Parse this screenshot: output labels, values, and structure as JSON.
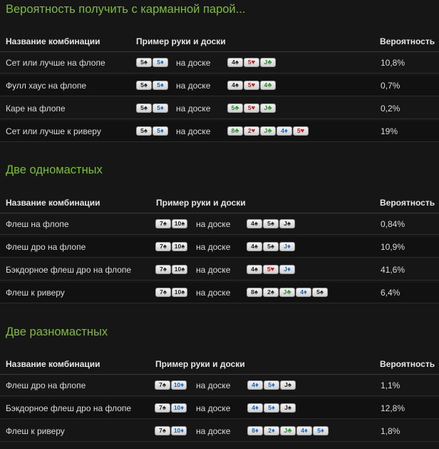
{
  "sections": [
    {
      "title": "Вероятность получить с карманной парой...",
      "headers": {
        "name": "Название комбинации",
        "example": "Пример руки и доски",
        "prob": "Вероятность"
      },
      "rows": [
        {
          "name": "Сет или лучше на флопе",
          "hand": [
            [
              "5",
              "s"
            ],
            [
              "5",
              "d"
            ]
          ],
          "on_board": "на доске",
          "board": [
            [
              "4",
              "s"
            ],
            [
              "5",
              "h"
            ],
            [
              "J",
              "c"
            ]
          ],
          "prob": "10,8%"
        },
        {
          "name": "Фулл хаус на флопе",
          "hand": [
            [
              "5",
              "s"
            ],
            [
              "5",
              "d"
            ]
          ],
          "on_board": "на доске",
          "board": [
            [
              "4",
              "s"
            ],
            [
              "5",
              "h"
            ],
            [
              "4",
              "c"
            ]
          ],
          "prob": "0,7%"
        },
        {
          "name": "Каре на флопе",
          "hand": [
            [
              "5",
              "s"
            ],
            [
              "5",
              "d"
            ]
          ],
          "on_board": "на доске",
          "board": [
            [
              "5",
              "c"
            ],
            [
              "5",
              "h"
            ],
            [
              "J",
              "c"
            ]
          ],
          "prob": "0,2%"
        },
        {
          "name": "Сет или лучше к риверу",
          "hand": [
            [
              "5",
              "s"
            ],
            [
              "5",
              "d"
            ]
          ],
          "on_board": "на доске",
          "board": [
            [
              "8",
              "c"
            ],
            [
              "2",
              "h"
            ],
            [
              "J",
              "c"
            ],
            [
              "4",
              "d"
            ],
            [
              "5",
              "h"
            ]
          ],
          "prob": "19%"
        }
      ]
    },
    {
      "title": "Две одномастных",
      "headers": {
        "name": "Название комбинации",
        "example": "Пример руки и доски",
        "prob": "Вероятность"
      },
      "rows": [
        {
          "name": "Флеш на флопе",
          "hand": [
            [
              "7",
              "s"
            ],
            [
              "10",
              "s"
            ]
          ],
          "on_board": "на доске",
          "board": [
            [
              "4",
              "s"
            ],
            [
              "5",
              "s"
            ],
            [
              "J",
              "s"
            ]
          ],
          "prob": "0,84%"
        },
        {
          "name": "Флеш дро на флопе",
          "hand": [
            [
              "7",
              "s"
            ],
            [
              "10",
              "s"
            ]
          ],
          "on_board": "на доске",
          "board": [
            [
              "4",
              "s"
            ],
            [
              "5",
              "s"
            ],
            [
              "J",
              "d"
            ]
          ],
          "prob": "10,9%"
        },
        {
          "name": "Бэкдорное флеш дро на флопе",
          "hand": [
            [
              "7",
              "s"
            ],
            [
              "10",
              "s"
            ]
          ],
          "on_board": "на доске",
          "board": [
            [
              "4",
              "s"
            ],
            [
              "5",
              "h"
            ],
            [
              "J",
              "d"
            ]
          ],
          "prob": "41,6%"
        },
        {
          "name": "Флеш к риверу",
          "hand": [
            [
              "7",
              "s"
            ],
            [
              "10",
              "s"
            ]
          ],
          "on_board": "на доске",
          "board": [
            [
              "8",
              "s"
            ],
            [
              "2",
              "s"
            ],
            [
              "J",
              "c"
            ],
            [
              "4",
              "d"
            ],
            [
              "5",
              "s"
            ]
          ],
          "prob": "6,4%"
        }
      ]
    },
    {
      "title": "Две разномастных",
      "headers": {
        "name": "Название комбинации",
        "example": "Пример руки и доски",
        "prob": "Вероятность"
      },
      "rows": [
        {
          "name": "Флеш дро на флопе",
          "hand": [
            [
              "7",
              "s"
            ],
            [
              "10",
              "d"
            ]
          ],
          "on_board": "на доске",
          "board": [
            [
              "4",
              "d"
            ],
            [
              "5",
              "d"
            ],
            [
              "J",
              "s"
            ]
          ],
          "prob": "1,1%"
        },
        {
          "name": "Бэкдорное флеш дро на флопе",
          "hand": [
            [
              "7",
              "s"
            ],
            [
              "10",
              "d"
            ]
          ],
          "on_board": "на доске",
          "board": [
            [
              "4",
              "d"
            ],
            [
              "5",
              "d"
            ],
            [
              "J",
              "s"
            ]
          ],
          "prob": "12,8%"
        },
        {
          "name": "Флеш к риверу",
          "hand": [
            [
              "7",
              "s"
            ],
            [
              "10",
              "d"
            ]
          ],
          "on_board": "на доске",
          "board": [
            [
              "8",
              "d"
            ],
            [
              "2",
              "d"
            ],
            [
              "J",
              "c"
            ],
            [
              "4",
              "d"
            ],
            [
              "5",
              "d"
            ]
          ],
          "prob": "1,8%"
        }
      ]
    }
  ]
}
